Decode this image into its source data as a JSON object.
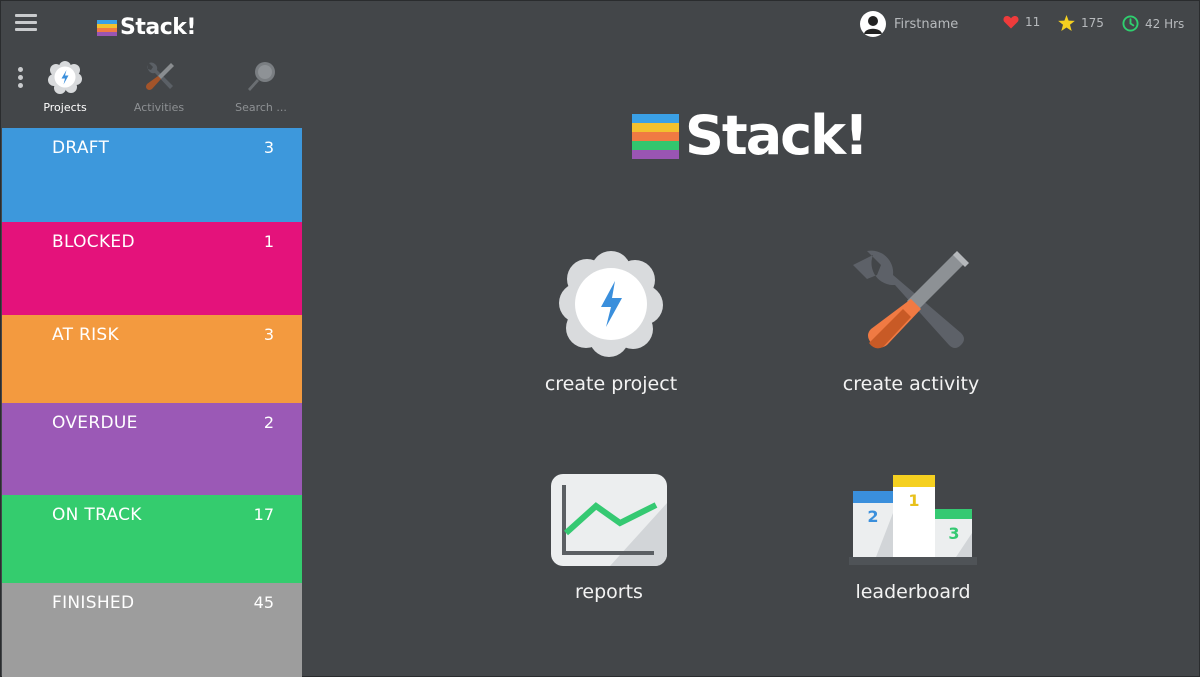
{
  "app": {
    "logo_text": "Stack!"
  },
  "brand_colors": [
    "#3aa0e6",
    "#f2c12e",
    "#f07a43",
    "#33c66e",
    "#9a55b3"
  ],
  "user": {
    "name": "Firstname"
  },
  "stats": {
    "hearts": "11",
    "stars": "175",
    "hours": "42 Hrs"
  },
  "nav": {
    "projects": "Projects",
    "activities": "Activities",
    "search": "Search ..."
  },
  "statuses": [
    {
      "label": "DRAFT",
      "count": "3",
      "color": "#3d98dc"
    },
    {
      "label": "BLOCKED",
      "count": "1",
      "color": "#e4127b"
    },
    {
      "label": "AT RISK",
      "count": "3",
      "color": "#f39a3f"
    },
    {
      "label": "OVERDUE",
      "count": "2",
      "color": "#9b59b6"
    },
    {
      "label": "ON TRACK",
      "count": "17",
      "color": "#34cc6e"
    },
    {
      "label": "FINISHED",
      "count": "45",
      "color": "#9d9d9d"
    }
  ],
  "actions": {
    "create_project": "create project",
    "create_activity": "create activity",
    "reports": "reports",
    "leaderboard": "leaderboard"
  },
  "podium": {
    "first": "1",
    "second": "2",
    "third": "3"
  }
}
